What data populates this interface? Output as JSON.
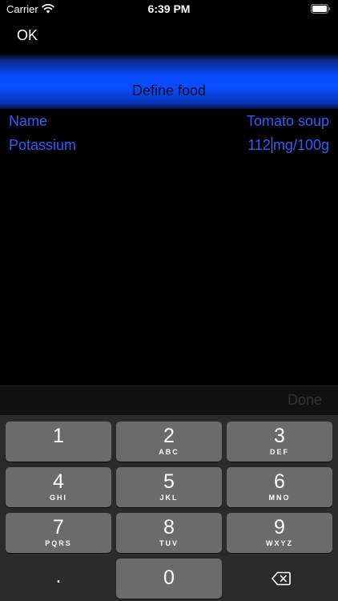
{
  "status_bar": {
    "carrier": "Carrier",
    "time": "6:39 PM",
    "wifi_icon": "wifi-icon",
    "battery_icon": "battery-icon"
  },
  "nav": {
    "ok_label": "OK"
  },
  "title": "Define food",
  "form": {
    "rows": [
      {
        "label": "Name",
        "value": "Tomato soup"
      },
      {
        "label": "Potassium",
        "value_entered": "112",
        "value_unit": "mg/100g"
      }
    ]
  },
  "keyboard": {
    "done_label": "Done",
    "keys": [
      {
        "digit": "1",
        "letters": ""
      },
      {
        "digit": "2",
        "letters": "ABC"
      },
      {
        "digit": "3",
        "letters": "DEF"
      },
      {
        "digit": "4",
        "letters": "GHI"
      },
      {
        "digit": "5",
        "letters": "JKL"
      },
      {
        "digit": "6",
        "letters": "MNO"
      },
      {
        "digit": "7",
        "letters": "PQRS"
      },
      {
        "digit": "8",
        "letters": "TUV"
      },
      {
        "digit": "9",
        "letters": "WXYZ"
      },
      {
        "digit": ".",
        "letters": ""
      },
      {
        "digit": "0",
        "letters": ""
      }
    ],
    "backspace_icon": "backspace-icon"
  },
  "colors": {
    "accent_blue": "#0a4cff",
    "field_text": "#2f5bff",
    "key_background": "#6b6b6b"
  }
}
